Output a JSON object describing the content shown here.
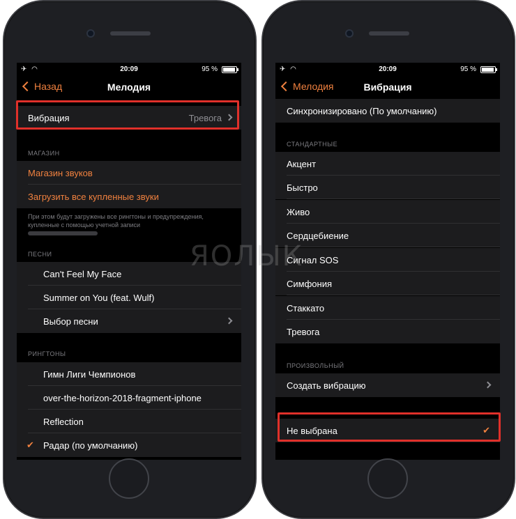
{
  "watermark": "ЯОЛЫК",
  "left_screen": {
    "status": {
      "time": "20:09",
      "battery": "95 %",
      "icons": "✈ ◠"
    },
    "nav": {
      "back_label": "Назад",
      "title": "Мелодия"
    },
    "vibration_row": {
      "label": "Вибрация",
      "value": "Тревога"
    },
    "store": {
      "header": "МАГАЗИН",
      "items": [
        "Магазин звуков",
        "Загрузить все купленные звуки"
      ],
      "footnote": "При этом будут загружены все рингтоны и предупреждения, купленные с помощью учетной записи"
    },
    "songs": {
      "header": "ПЕСНИ",
      "items": [
        "Can't Feel My Face",
        "Summer on You (feat. Wulf)",
        "Выбор песни"
      ]
    },
    "ringtones": {
      "header": "РИНГТОНЫ",
      "items": [
        "Гимн Лиги Чемпионов",
        "over-the-horizon-2018-fragment-iphone",
        "Reflection",
        "Радар (по умолчанию)"
      ]
    }
  },
  "right_screen": {
    "status": {
      "time": "20:09",
      "battery": "95 %",
      "icons": "✈ ◠"
    },
    "nav": {
      "back_label": "Мелодия",
      "title": "Вибрация"
    },
    "synced": "Синхронизировано (По умолчанию)",
    "standard": {
      "header": "СТАНДАРТНЫЕ",
      "items": [
        "Акцент",
        "Быстро",
        "Живо",
        "Сердцебиение",
        "Сигнал SOS",
        "Симфония",
        "Стаккато",
        "Тревога"
      ]
    },
    "custom": {
      "header": "ПРОИЗВОЛЬНЫЙ",
      "create": "Создать вибрацию"
    },
    "none": "Не выбрана"
  },
  "accent_color": "#f0813f",
  "highlight_color": "#e0302a"
}
